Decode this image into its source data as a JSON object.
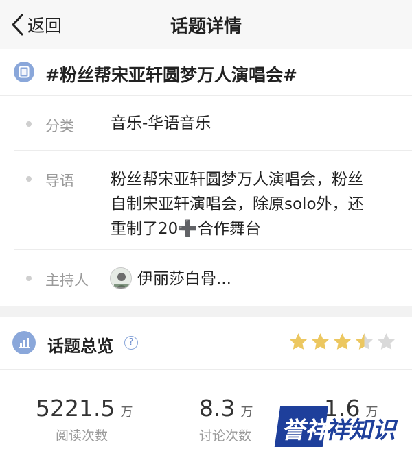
{
  "nav": {
    "back_label": "返回",
    "title": "话题详情"
  },
  "topic": {
    "title": "#粉丝帮宋亚轩圆梦万人演唱会#",
    "icon": "document-icon",
    "accent_color": "#8aa7da"
  },
  "info": {
    "category": {
      "label": "分类",
      "value": "音乐-华语音乐"
    },
    "intro": {
      "label": "导语",
      "lines": [
        "粉丝帮宋亚轩圆梦万人演唱会，粉丝",
        "自制宋亚轩演唱会，除原solo外，还",
        "重制了20➕合作舞台"
      ]
    },
    "host": {
      "label": "主持人",
      "name": "伊丽莎白骨..."
    }
  },
  "overview": {
    "title": "话题总览",
    "help_icon": "question-circle-icon",
    "rating": 3.5,
    "rating_max": 5,
    "star_color": "#ecc760"
  },
  "stats": [
    {
      "value": "5221.5",
      "unit": "万",
      "label": "阅读次数"
    },
    {
      "value": "8.3",
      "unit": "万",
      "label": "讨论次数"
    },
    {
      "value": "1.6",
      "unit": "万",
      "label": ""
    }
  ],
  "watermark": {
    "text_a": "誉祥",
    "text_b": "祥知识"
  }
}
